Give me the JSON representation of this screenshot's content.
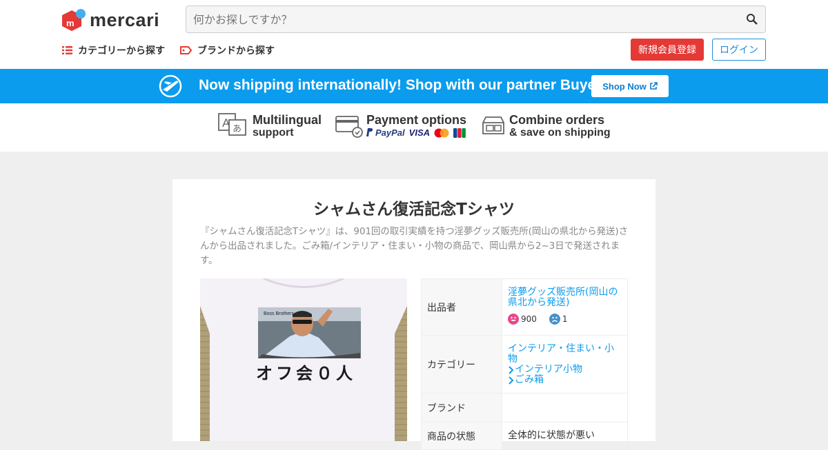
{
  "header": {
    "logo_text": "mercari",
    "search": {
      "placeholder": "何かお探しですか？"
    },
    "nav": {
      "category": "カテゴリーから探す",
      "brand": "ブランドから探す"
    },
    "signup_label": "新規会員登録",
    "login_label": "ログイン"
  },
  "banner": {
    "text": "Now shipping internationally! Shop with our partner Buyee!",
    "shop_now_label": "Shop Now"
  },
  "features": {
    "multilingual": {
      "line1": "Multilingual",
      "line2": "support"
    },
    "payment": {
      "title": "Payment options",
      "paypal": "PayPal",
      "visa": "VISA",
      "jcb": "JCB"
    },
    "combine": {
      "line1": "Combine orders",
      "line2": "& save on shipping"
    }
  },
  "item": {
    "title": "シャムさん復活記念Tシャツ",
    "description": "『シャムさん復活記念Tシャツ』は、901回の取引実績を持つ淫夢グッズ販売所(岡山の県北から発送)さんから出品されました。ごみ箱/インテリア・住まい・小物の商品で、岡山県から2~3日で発送されます。",
    "shirt_text": "オフ会０人",
    "photo_brand": "Boss Brothers"
  },
  "info": {
    "seller_key": "出品者",
    "seller_name": "淫夢グッズ販売所(岡山の県北から発送)",
    "rating_good": "900",
    "rating_bad": "1",
    "category_key": "カテゴリー",
    "category_main": "インテリア・住まい・小物",
    "category_sub1": "インテリア小物",
    "category_sub2": "ごみ箱",
    "brand_key": "ブランド",
    "brand_val": "",
    "condition_key": "商品の状態",
    "condition_val": "全体的に状態が悪い"
  },
  "colors": {
    "brand_red": "#e53935",
    "accent_blue": "#0b9ced",
    "login_blue": "#1f8cd8"
  }
}
